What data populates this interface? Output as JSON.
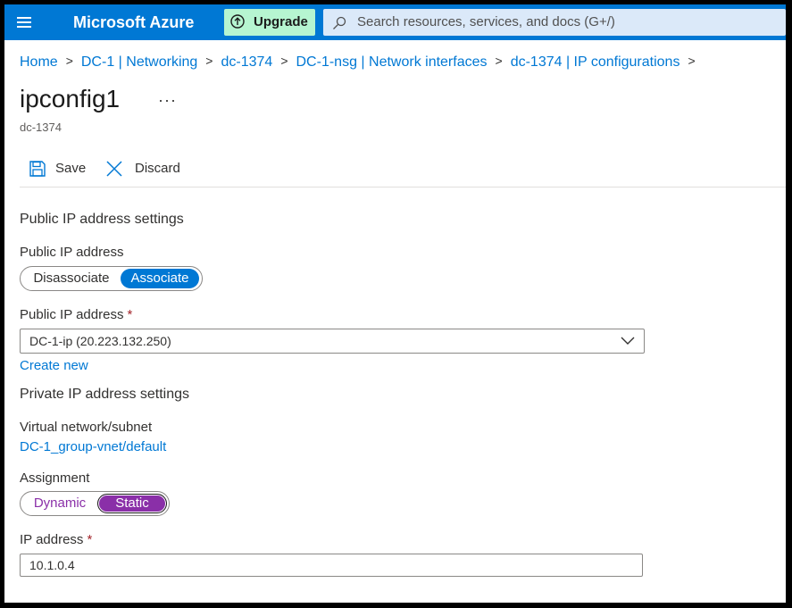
{
  "topbar": {
    "brand": "Microsoft Azure",
    "upgrade_label": "Upgrade",
    "search_placeholder": "Search resources, services, and docs (G+/)",
    "colors": {
      "bar": "#0078d4",
      "upgrade": "#b6f5d1",
      "search": "#dbe9f9"
    }
  },
  "breadcrumb": {
    "items": [
      "Home",
      "DC-1 | Networking",
      "dc-1374",
      "DC-1-nsg | Network interfaces",
      "dc-1374 | IP configurations"
    ],
    "separator": ">"
  },
  "page": {
    "title": "ipconfig1",
    "more": "···",
    "subtitle": "dc-1374"
  },
  "toolbar": {
    "save_label": "Save",
    "discard_label": "Discard"
  },
  "public_ip": {
    "heading": "Public IP address settings",
    "toggle_label": "Public IP address",
    "options": [
      "Disassociate",
      "Associate"
    ],
    "selected": "Associate",
    "select_label": "Public IP address",
    "required_mark": "*",
    "select_value": "DC-1-ip (20.223.132.250)",
    "create_new": "Create new"
  },
  "private_ip": {
    "heading": "Private IP address settings",
    "vnet_label": "Virtual network/subnet",
    "vnet_value": "DC-1_group-vnet/default",
    "assignment_label": "Assignment",
    "options": [
      "Dynamic",
      "Static"
    ],
    "selected": "Static",
    "ip_label": "IP address",
    "required_mark": "*",
    "ip_value": "10.1.0.4"
  },
  "colors": {
    "accent": "#0078d4",
    "static_purple": "#8a2fa8",
    "required": "#a4262c"
  }
}
